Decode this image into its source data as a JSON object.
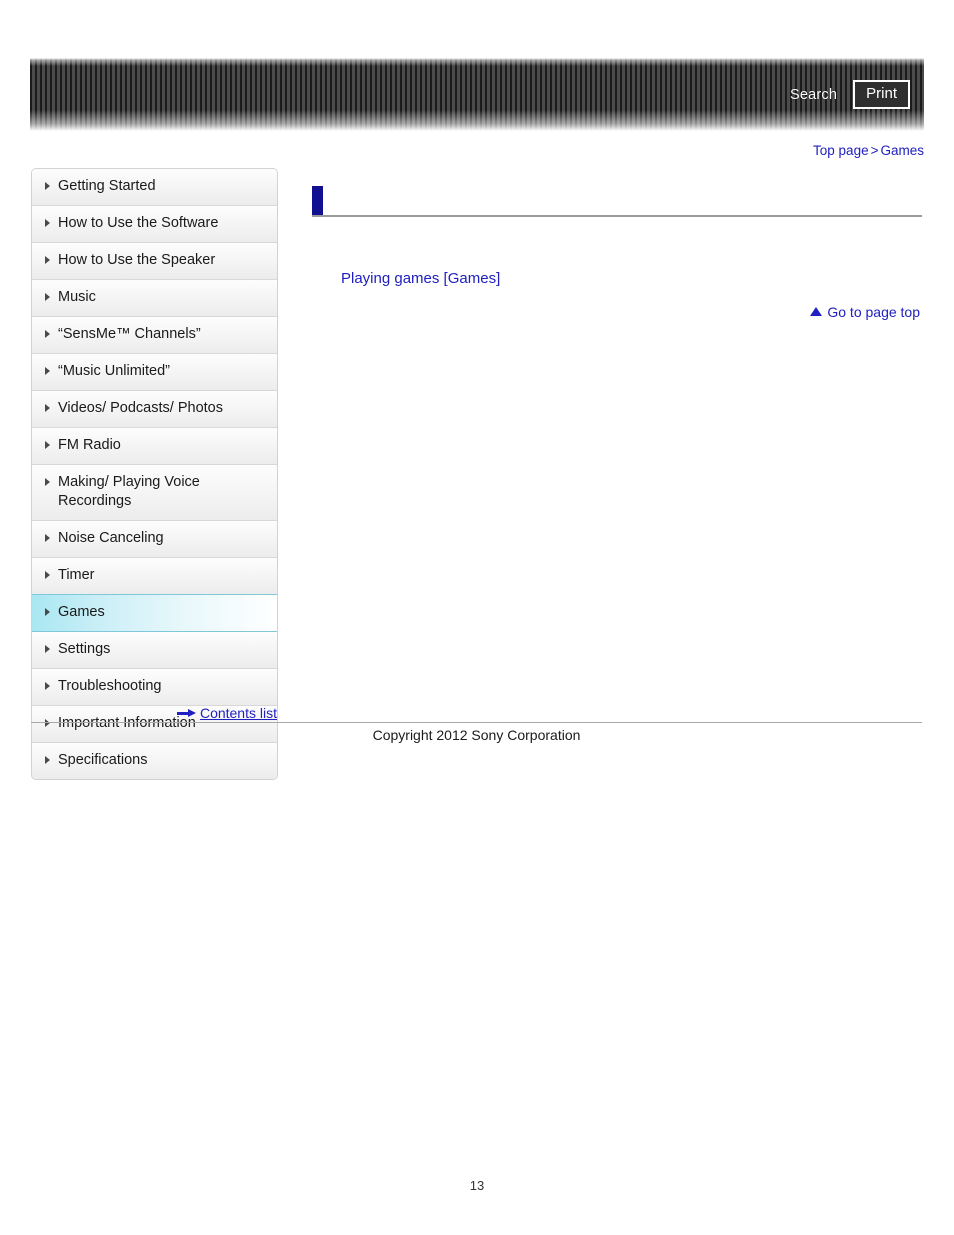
{
  "header": {
    "search_label": "Search",
    "print_label": "Print",
    "search_icon": "search-icon",
    "print_icon": "printer-icon"
  },
  "breadcrumb": {
    "top_page": "Top page",
    "separator": ">",
    "current": "Games"
  },
  "sidebar": {
    "items": [
      {
        "label": "Getting Started",
        "active": false
      },
      {
        "label": "How to Use the Software",
        "active": false
      },
      {
        "label": "How to Use the Speaker",
        "active": false
      },
      {
        "label": "Music",
        "active": false
      },
      {
        "label": "“SensMe™ Channels”",
        "active": false
      },
      {
        "label": "“Music Unlimited”",
        "active": false
      },
      {
        "label": "Videos/ Podcasts/ Photos",
        "active": false
      },
      {
        "label": "FM Radio",
        "active": false
      },
      {
        "label": "Making/ Playing Voice Recordings",
        "active": false
      },
      {
        "label": "Noise Canceling",
        "active": false
      },
      {
        "label": "Timer",
        "active": false
      },
      {
        "label": "Games",
        "active": true
      },
      {
        "label": "Settings",
        "active": false
      },
      {
        "label": "Troubleshooting",
        "active": false
      },
      {
        "label": "Important Information",
        "active": false
      },
      {
        "label": "Specifications",
        "active": false
      }
    ],
    "contents_list_label": "Contents list",
    "contents_list_icon": "arrow-right-icon"
  },
  "main": {
    "heading": "",
    "topics": [
      {
        "label": "Playing games [Games]"
      }
    ],
    "go_to_page_top_label": "Go to page top",
    "go_to_page_top_icon": "triangle-up-icon"
  },
  "footer": {
    "copyright": "Copyright 2012 Sony Corporation"
  },
  "page_number": "13",
  "colors": {
    "link_blue": "#2020c0",
    "heading_navy": "#101090",
    "active_cyan": "#a9e7f2",
    "header_dark": "#1b1b1b"
  }
}
